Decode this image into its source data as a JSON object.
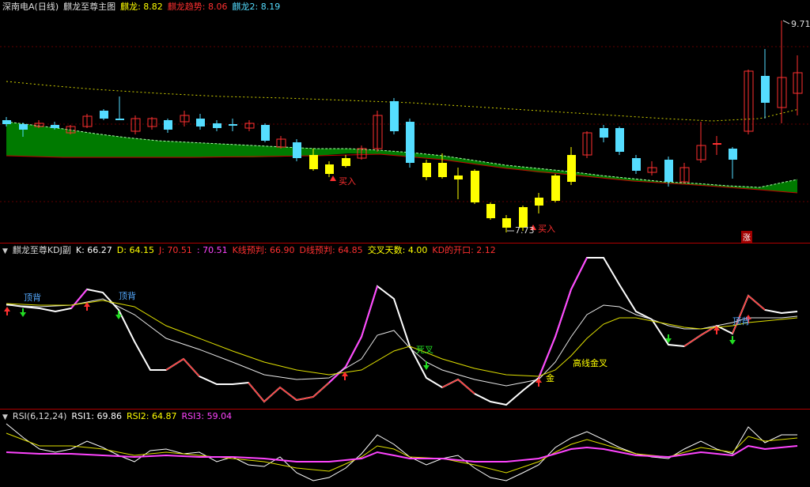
{
  "main": {
    "title": "深南电A(日线)",
    "indicator": "麒龙至尊主图",
    "legend": [
      {
        "label": "麒龙: 8.82",
        "color": "#ffff00"
      },
      {
        "label": "麒龙趋势: 8.06",
        "color": "#ff3030"
      },
      {
        "label": "麒龙2: 8.19",
        "color": "#55ddff"
      }
    ],
    "high_label": "9.71",
    "low_label": "7.73",
    "buy_label": "买入",
    "zhang_badge": "涨"
  },
  "kdj": {
    "title": "麒龙至尊KDJ副",
    "values": [
      {
        "label": "K: 66.27",
        "color": "#ffffff"
      },
      {
        "label": "D: 64.15",
        "color": "#ffff00"
      },
      {
        "label": "J: 70.51",
        "color": "#ff3030"
      },
      {
        "label": ": 70.51",
        "color": "#ff44ff"
      },
      {
        "label": "K线预判: 66.90",
        "color": "#ff3030"
      },
      {
        "label": "D线预判: 64.85",
        "color": "#ff3030"
      },
      {
        "label": "交叉天数: 4.00",
        "color": "#ffff00"
      },
      {
        "label": "KD的开口: 2.12",
        "color": "#ff3030"
      }
    ],
    "annotations": {
      "top1": "顶背",
      "top2": "顶背",
      "top3": "顶背",
      "deadcross": "死叉",
      "goldcross": "高线金叉",
      "jin": "金"
    }
  },
  "rsi": {
    "title": "RSI(6,12,24)",
    "values": [
      {
        "label": "RSI1: 69.86",
        "color": "#ffffff"
      },
      {
        "label": "RSI2: 64.87",
        "color": "#ffff00"
      },
      {
        "label": "RSI3: 59.04",
        "color": "#ff44ff"
      }
    ]
  },
  "chart_data": {
    "type": "candlestick",
    "series": [
      {
        "name": "麒龙",
        "values": []
      },
      {
        "name": "麒龙趋势",
        "values": []
      },
      {
        "name": "麒龙2",
        "values": []
      }
    ]
  }
}
